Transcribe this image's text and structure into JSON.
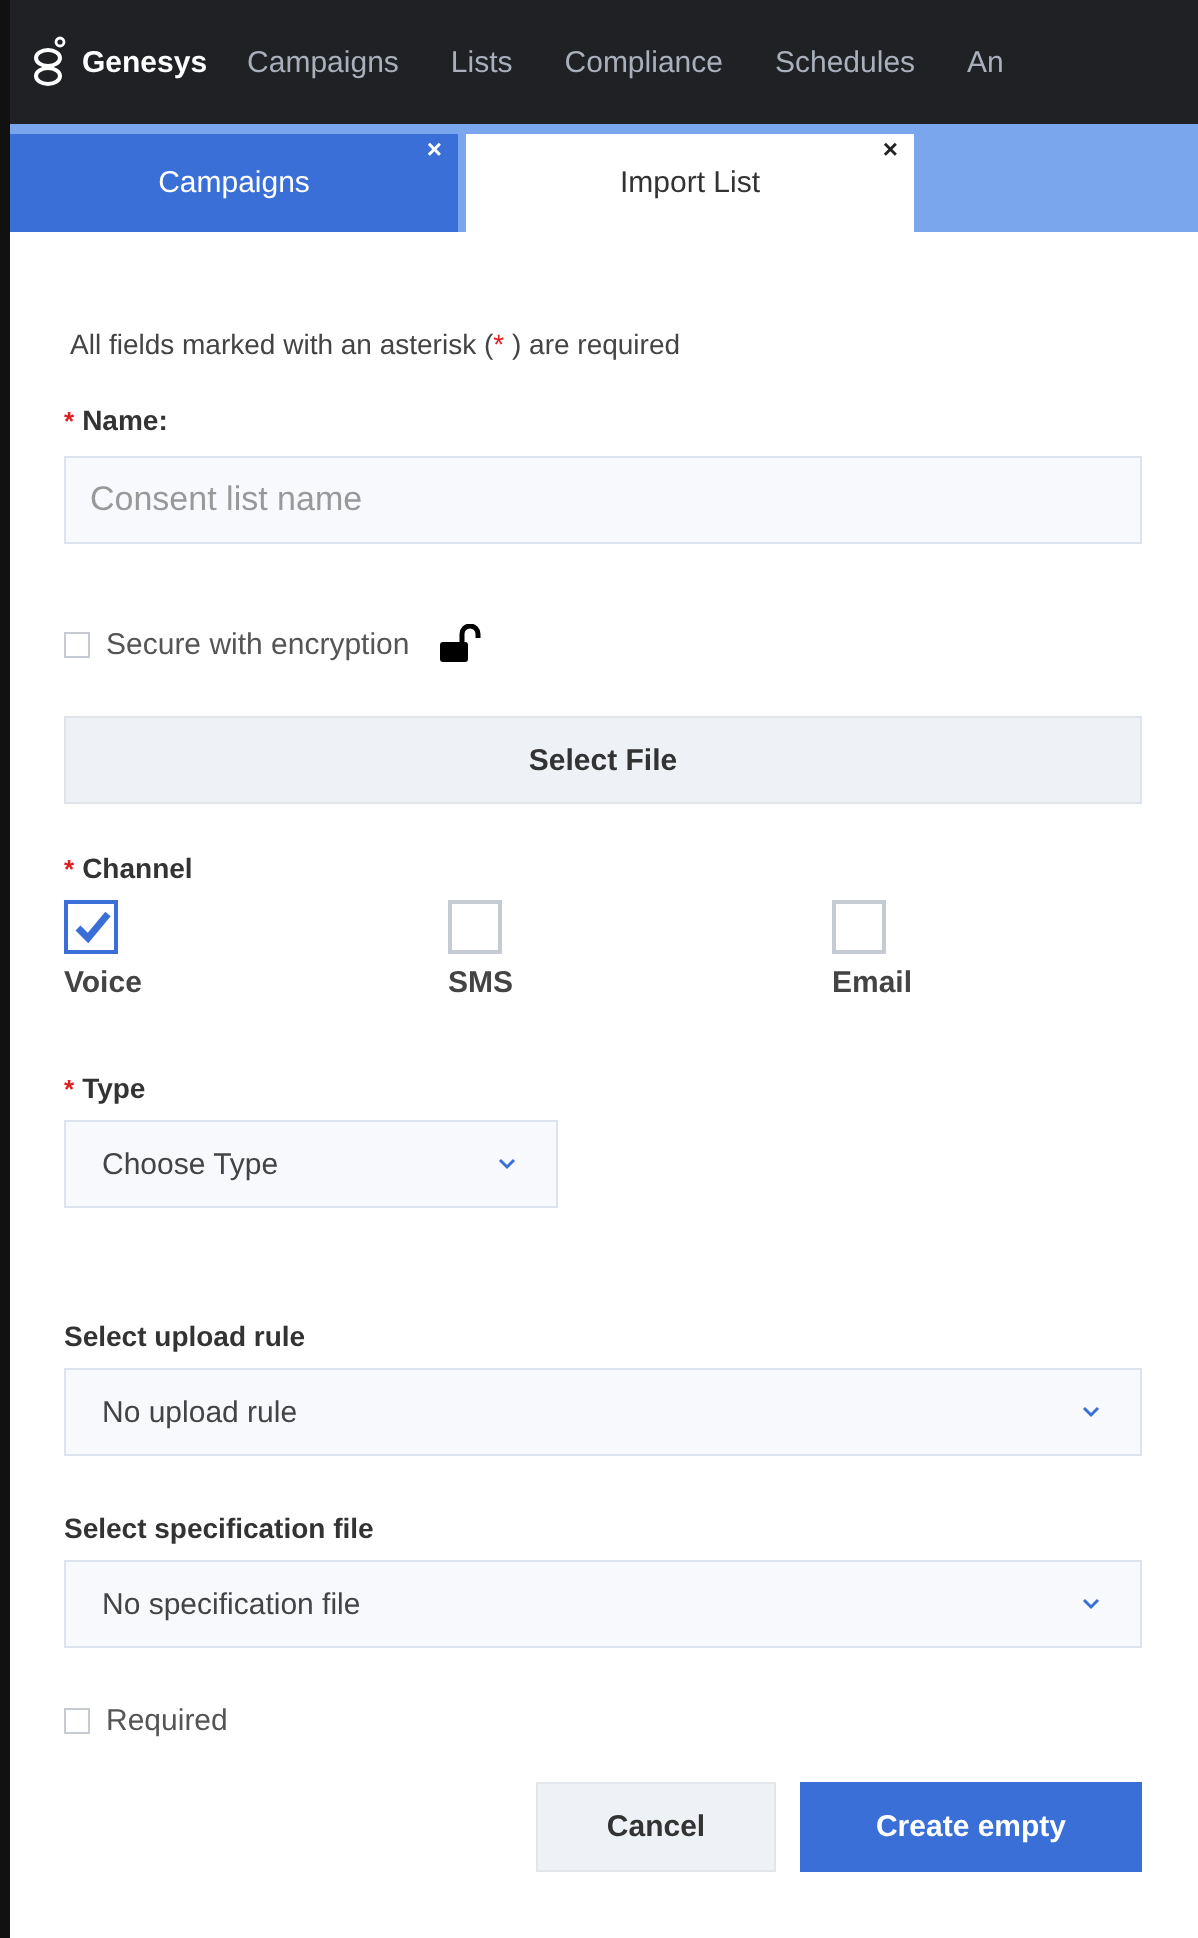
{
  "nav": {
    "brand": "Genesys",
    "items": [
      "Campaigns",
      "Lists",
      "Compliance",
      "Schedules",
      "An"
    ]
  },
  "tabs": [
    {
      "label": "Campaigns",
      "selected": false,
      "close": "×"
    },
    {
      "label": "Import List",
      "selected": true,
      "close": "×"
    }
  ],
  "note": {
    "before": "All fields marked with an asterisk (",
    "mark": "*",
    "after": " ) are required"
  },
  "name_field": {
    "required_mark": "*",
    "label": "Name:",
    "placeholder": "Consent list name"
  },
  "encryption": {
    "label": "Secure with encryption",
    "checked": false
  },
  "select_file": "Select File",
  "channel": {
    "required_mark": "*",
    "label": "Channel",
    "options": [
      {
        "label": "Voice",
        "checked": true
      },
      {
        "label": "SMS",
        "checked": false
      },
      {
        "label": "Email",
        "checked": false
      }
    ]
  },
  "type": {
    "required_mark": "*",
    "label": "Type",
    "value": "Choose Type"
  },
  "upload_rule": {
    "label": "Select upload rule",
    "value": "No upload rule"
  },
  "spec_file": {
    "label": "Select specification file",
    "value": "No specification file"
  },
  "required": {
    "label": "Required",
    "checked": false
  },
  "buttons": [
    {
      "label": "Cancel",
      "kind": "secondary"
    },
    {
      "label": "Create empty",
      "kind": "primary"
    }
  ]
}
